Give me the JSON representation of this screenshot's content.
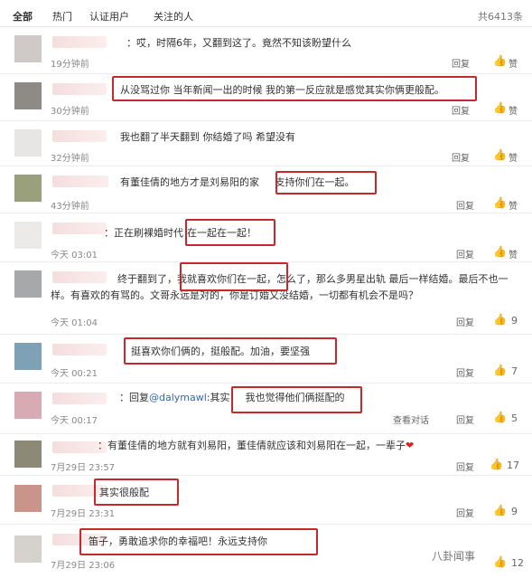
{
  "tabs": {
    "all": "全部",
    "hot": "热门",
    "verified": "认证用户",
    "following": "关注的人",
    "total": "共6413条"
  },
  "actions": {
    "reply": "回复",
    "like": "赞",
    "view_conversation": "查看对话"
  },
  "comments": [
    {
      "text": "：哎，时隔6年，又翻到这了。竟然不知该盼望什么",
      "time": "19分钟前"
    },
    {
      "text": "从没骂过你 当年新闻一出的时候 我的第一反应就是感觉其实你俩更般配。",
      "time": "30分钟前"
    },
    {
      "text": "我也翻了半天翻到 你结婚了吗 希望没有",
      "time": "32分钟前"
    },
    {
      "text": "有董佳倩的地方才是刘易阳的家",
      "text_hl": "支持你们在一起。",
      "time": "43分钟前"
    },
    {
      "text": "：正在刷裸婚时代",
      "text_hl": "在一起在一起！",
      "time": "今天 03:01"
    },
    {
      "text": "终于翻到了，我就喜欢你们在一起，怎么了，那么多男星出轨 最后一样结婚。最后不也一样。有喜欢的有骂的。文哥永远是对的，你是订婚又没结婚，一切都有机会不是吗？",
      "time": "今天 01:04",
      "likes": "9"
    },
    {
      "text": "挺喜欢你们俩的，挺般配。加油，要坚强",
      "time": "今天 00:21",
      "likes": "7"
    },
    {
      "reply_prefix": "：回复",
      "mention": "@dalymawl",
      "reply_mid": ":其实，",
      "text_hl": "我也觉得他们俩挺配的",
      "time": "今天 00:17",
      "likes": "5"
    },
    {
      "text": "：有董佳倩的地方就有刘易阳，董佳倩就应该和刘易阳在一起，一辈子",
      "heart": "❤",
      "time": "7月29日 23:57",
      "likes": "17"
    },
    {
      "text": "其实很般配",
      "time": "7月29日 23:31",
      "likes": "9"
    },
    {
      "text": "笛子，勇敢追求你的幸福吧！永远支持你",
      "time": "7月29日 23:06",
      "likes": "12"
    }
  ],
  "watermark": "八卦闻事"
}
